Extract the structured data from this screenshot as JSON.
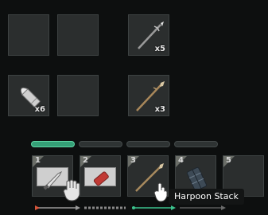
{
  "inventory": {
    "slots": [
      {
        "item": "",
        "count": ""
      },
      {
        "item": "",
        "count": ""
      },
      {
        "item": "harpoon",
        "count": "x5"
      },
      {
        "item": "bullet",
        "count": "x6"
      },
      {
        "item": "",
        "count": ""
      },
      {
        "item": "spear",
        "count": "x3"
      }
    ]
  },
  "category_tabs": {
    "active_index": 0,
    "count": 4
  },
  "hotbar": {
    "slots": [
      {
        "number": "1",
        "item": "knife"
      },
      {
        "number": "2",
        "item": "red-item"
      },
      {
        "number": "3",
        "item": "harpoon"
      },
      {
        "number": "4",
        "item": "armor"
      },
      {
        "number": "5",
        "item": ""
      }
    ]
  },
  "tooltip": {
    "text": "Harpoon Stack"
  },
  "colors": {
    "accent_green": "#35a077",
    "slot_bg": "#2b2e2e",
    "background": "#0d0f0f"
  }
}
